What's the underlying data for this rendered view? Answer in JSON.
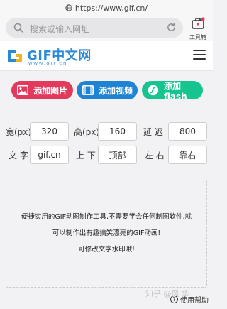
{
  "browser": {
    "url": "https://www.gif.cn/",
    "search_placeholder": "搜索或输入网址",
    "toolbox_label": "工具箱"
  },
  "header": {
    "logo_text": "GIF中文网",
    "logo_sub": "WWW.GIF.CN"
  },
  "actions": {
    "add_image": "添加图片",
    "add_video": "添加视频",
    "add_flash": "添加flash"
  },
  "form": {
    "width_label": "宽(px)",
    "width_value": "320",
    "height_label": "高(px)",
    "height_value": "160",
    "delay_label": "延 迟",
    "delay_value": "800",
    "text_label": "文 字",
    "text_value": "gif.cn",
    "vertical_label": "上 下",
    "vertical_value": "顶部",
    "horizontal_label": "左 右",
    "horizontal_value": "靠右"
  },
  "dropzone": {
    "line1": "便捷实用的GIF动图制作工具,不需要学会任何制图软件,就",
    "line2": "可以制作出有趣搞笑漂亮的GIF动画!",
    "line3": "可修改文字水印哦!"
  },
  "watermark": "知乎 @风  华",
  "help_label": "使用帮助",
  "colors": {
    "image_button": "#e23a5c",
    "video_button": "#1f83d4",
    "flash_button": "#17c48f",
    "brand": "#2a8ad8"
  }
}
